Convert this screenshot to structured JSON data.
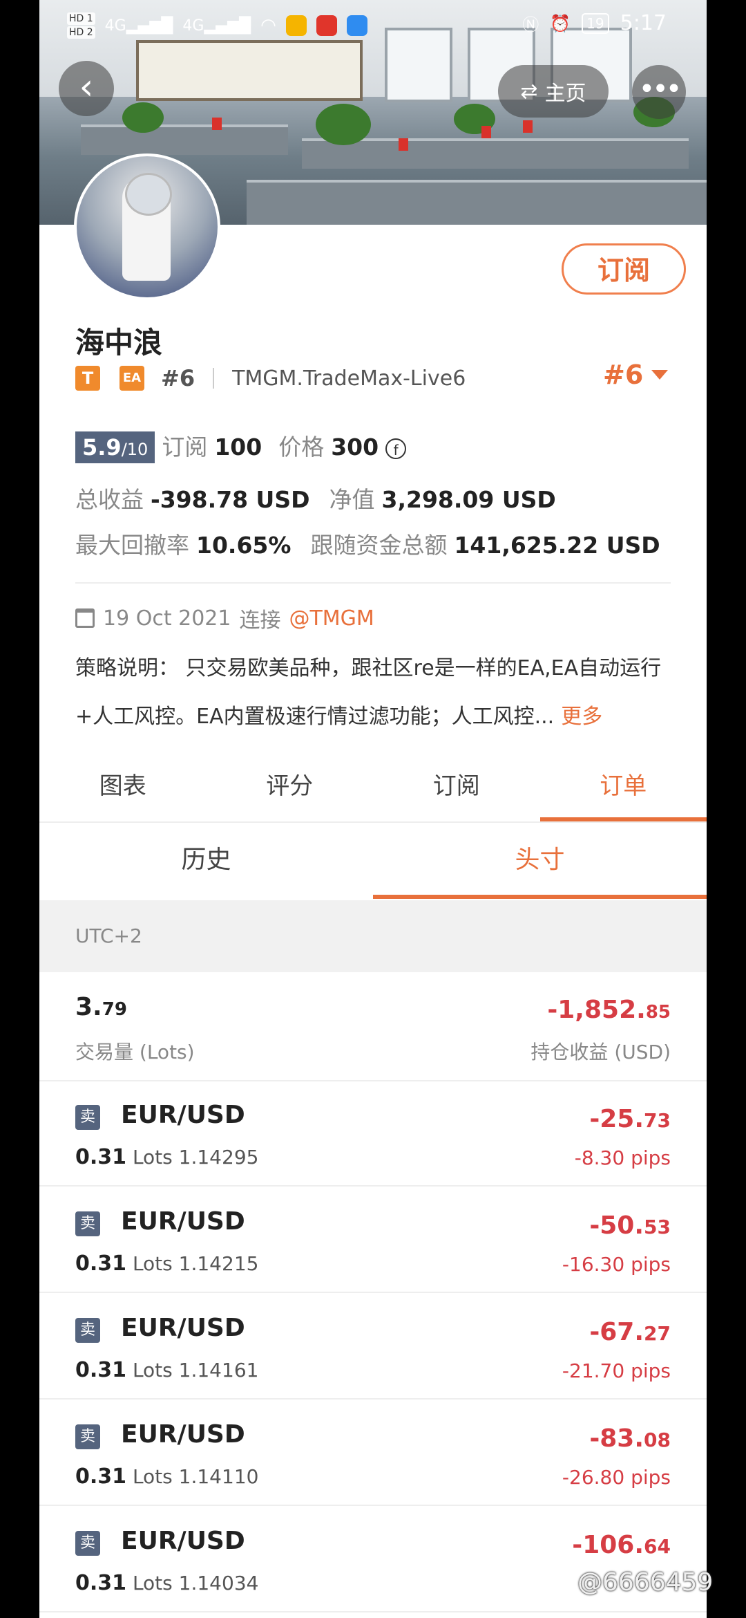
{
  "status_bar": {
    "left_chips": [
      "HD 1",
      "HD 2"
    ],
    "signal_labels": [
      "4G",
      "4G"
    ],
    "battery": "19",
    "time": "5:17"
  },
  "nav": {
    "home_label": "主页"
  },
  "profile": {
    "name": "海中浪",
    "tag_t": "T",
    "tag_ea": "EA",
    "rank_small": "#6",
    "account": "TMGM.TradeMax-Live6",
    "rank_dropdown": "#6",
    "subscribe_label": "订阅"
  },
  "stats": {
    "score": "5.9",
    "score_denominator": "/10",
    "subscribe_label": "订阅",
    "subscribe_count": "100",
    "price_label": "价格",
    "price_value": "300",
    "coin_symbol": "f",
    "total_profit_label": "总收益",
    "total_profit_value": "-398.78 USD",
    "net_value_label": "净值",
    "net_value": "3,298.09 USD",
    "max_drawdown_label": "最大回撤率",
    "max_drawdown_value": "10.65%",
    "follow_funds_label": "跟随资金总额",
    "follow_funds_value": "141,625.22 USD"
  },
  "connection": {
    "date": "19 Oct 2021",
    "connect_label": "连接",
    "broker": "@TMGM"
  },
  "description": {
    "text": "策略说明： 只交易欧美品种，跟社区re是一样的EA,EA自动运行+人工风控。EA内置极速行情过滤功能；人工风控...",
    "more_label": "更多"
  },
  "tabs": [
    "图表",
    "评分",
    "订阅",
    "订单"
  ],
  "active_tab": 3,
  "subtabs": [
    "历史",
    "头寸"
  ],
  "active_subtab": 1,
  "timezone": "UTC+2",
  "summary": {
    "lots_int": "3.",
    "lots_dec": "79",
    "lots_label": "交易量 (Lots)",
    "pnl_int": "-1,852.",
    "pnl_dec": "85",
    "pnl_label": "持仓收益 (USD)"
  },
  "orders": [
    {
      "side": "卖",
      "symbol": "EUR/USD",
      "lots": "0.31",
      "lots_unit": "Lots",
      "price": "1.14295",
      "profit_int": "-25.",
      "profit_dec": "73",
      "pips": "-8.30 pips"
    },
    {
      "side": "卖",
      "symbol": "EUR/USD",
      "lots": "0.31",
      "lots_unit": "Lots",
      "price": "1.14215",
      "profit_int": "-50.",
      "profit_dec": "53",
      "pips": "-16.30 pips"
    },
    {
      "side": "卖",
      "symbol": "EUR/USD",
      "lots": "0.31",
      "lots_unit": "Lots",
      "price": "1.14161",
      "profit_int": "-67.",
      "profit_dec": "27",
      "pips": "-21.70 pips"
    },
    {
      "side": "卖",
      "symbol": "EUR/USD",
      "lots": "0.31",
      "lots_unit": "Lots",
      "price": "1.14110",
      "profit_int": "-83.",
      "profit_dec": "08",
      "pips": "-26.80 pips"
    },
    {
      "side": "卖",
      "symbol": "EUR/USD",
      "lots": "0.31",
      "lots_unit": "Lots",
      "price": "1.14034",
      "profit_int": "-106.",
      "profit_dec": "64",
      "pips": ""
    }
  ],
  "watermark": "@6666459",
  "colors": {
    "accent": "#e8703b",
    "negative": "#d63d44",
    "badge": "#55647e"
  }
}
